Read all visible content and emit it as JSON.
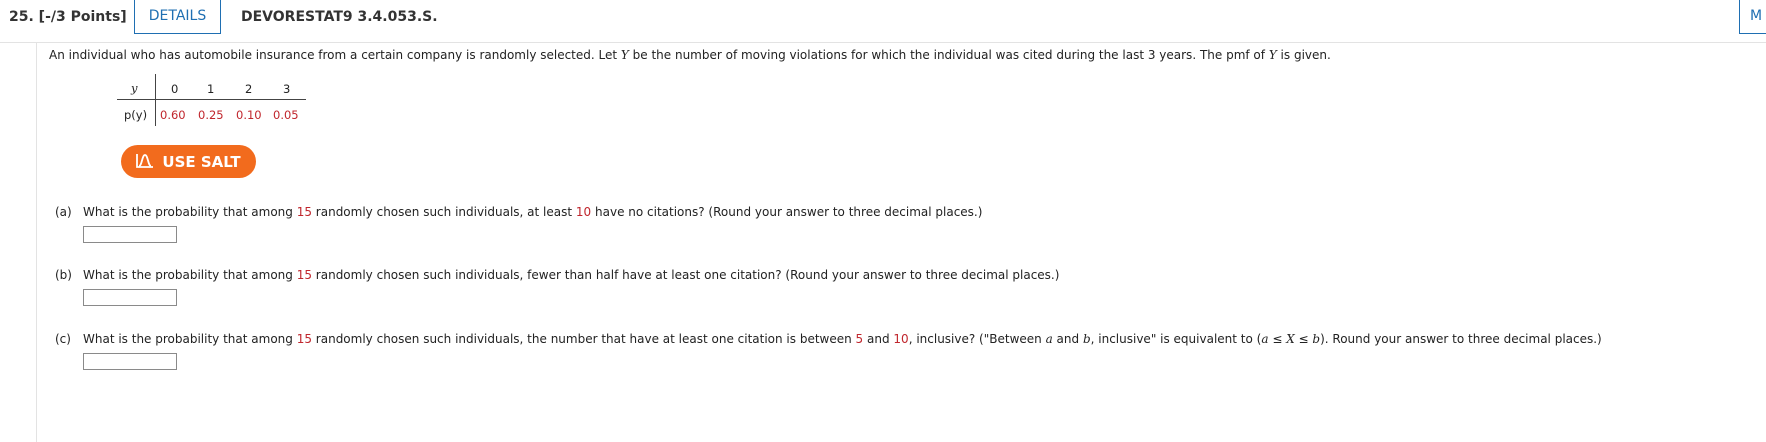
{
  "header": {
    "question_number": "25. [-/3 Points]",
    "details_label": "DETAILS",
    "question_code": "DEVORESTAT9 3.4.053.S.",
    "my_notes_label": "M"
  },
  "intro": {
    "text_1": "An individual who has automobile insurance from a certain company is randomly selected. Let ",
    "var_1": "Y",
    "text_2": " be the number of moving violations for which the individual was cited during the last 3 years. The pmf of ",
    "var_2": "Y",
    "text_3": " is given."
  },
  "pmf_table": {
    "row1_label": "y",
    "row2_label": "p(y)",
    "y_values": [
      "0",
      "1",
      "2",
      "3"
    ],
    "p_values": [
      "0.60",
      "0.25",
      "0.10",
      "0.05"
    ]
  },
  "salt": {
    "label": "USE SALT",
    "icon": "salt-chart-icon",
    "color": "#f26b1d"
  },
  "parts": [
    {
      "label": "(a)",
      "t1": "What is the probability that among ",
      "n1": "15",
      "t2": " randomly chosen such individuals, at least ",
      "n2": "10",
      "t3": " have no citations? (Round your answer to three decimal places.)"
    },
    {
      "label": "(b)",
      "t1": "What is the probability that among ",
      "n1": "15",
      "t2": " randomly chosen such individuals, fewer than half have at least one citation? (Round your answer to three decimal places.)"
    },
    {
      "label": "(c)",
      "t1": "What is the probability that among ",
      "n1": "15",
      "t2": " randomly chosen such individuals, the number that have at least one citation is between ",
      "n2": "5",
      "t3": " and ",
      "n3": "10",
      "t4": ", inclusive? (\"Between ",
      "a1": "a",
      "t5": " and ",
      "b1": "b",
      "t6": ", inclusive\" is equivalent to (",
      "a2": "a",
      "t7": " ≤ ",
      "x": "X",
      "t8": " ≤ ",
      "b2": "b",
      "t9": "). Round your answer to three decimal places.)"
    }
  ],
  "colors": {
    "accent_blue": "#1f6fb2",
    "red_value": "#c0262d"
  }
}
